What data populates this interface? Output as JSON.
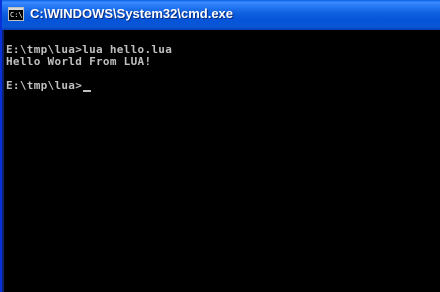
{
  "window": {
    "title": "C:\\WINDOWS\\System32\\cmd.exe",
    "icon_name": "cmd-icon",
    "icon_glyph": "C:\\"
  },
  "console": {
    "lines": [
      "E:\\tmp\\lua>lua hello.lua",
      "Hello World From LUA!",
      "",
      "E:\\tmp\\lua>"
    ],
    "text_color": "#c0c0c0",
    "background_color": "#000000"
  },
  "colors": {
    "titlebar": "#0553d8",
    "title_text": "#ffffff"
  }
}
